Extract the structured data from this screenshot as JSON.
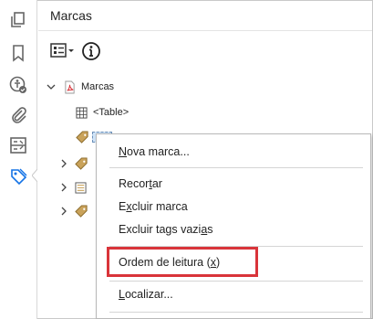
{
  "panel": {
    "title": "Marcas",
    "root_label": "Marcas",
    "table_label": "<Table>"
  },
  "menu": {
    "nova_marca": {
      "pre": "",
      "u": "N",
      "post": "ova marca..."
    },
    "recortar": {
      "pre": "Recor",
      "u": "t",
      "post": "ar"
    },
    "excluir_marca": {
      "pre": "E",
      "u": "x",
      "post": "cluir marca"
    },
    "excluir_tags": {
      "pre": "Excluir tags vazi",
      "u": "a",
      "post": "s"
    },
    "ordem_leitura": {
      "pre": "Ordem de leitura (",
      "u": "x",
      "post": ")"
    },
    "localizar": {
      "pre": "",
      "u": "L",
      "post": "ocalizar..."
    }
  },
  "colors": {
    "highlight": "#d9343a",
    "accent": "#1473e6"
  },
  "icons": {
    "toolbar": [
      "pages-icon",
      "bookmark-icon",
      "accessibility-icon",
      "attachment-icon",
      "fields-icon",
      "tags-icon"
    ]
  }
}
